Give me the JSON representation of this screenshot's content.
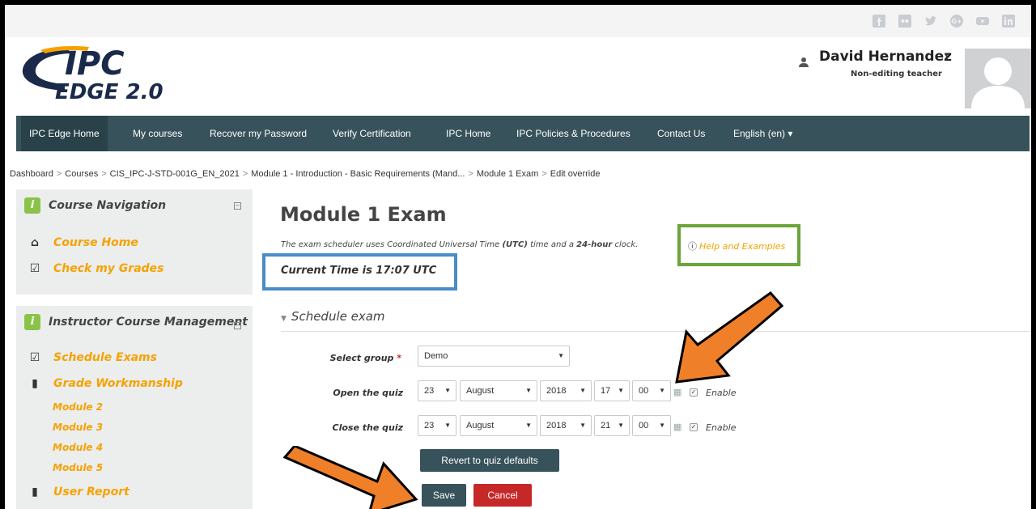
{
  "social": [
    {
      "name": "facebook-icon"
    },
    {
      "name": "flickr-icon"
    },
    {
      "name": "twitter-icon"
    },
    {
      "name": "google-plus-icon"
    },
    {
      "name": "youtube-icon"
    },
    {
      "name": "linkedin-icon"
    }
  ],
  "logo": {
    "line1": "IPC",
    "line2": "EDGE 2.0"
  },
  "user": {
    "name": "David Hernandez",
    "role": "Non-editing teacher"
  },
  "nav": {
    "items": [
      "IPC Edge Home",
      "My courses",
      "Recover my Password",
      "Verify Certification",
      "IPC Home",
      "IPC Policies & Procedures",
      "Contact Us",
      "English (en) ▾"
    ]
  },
  "breadcrumb": [
    "Dashboard",
    "Courses",
    "CIS_IPC-J-STD-001G_EN_2021",
    "Module 1 - Introduction - Basic Requirements (Mand...",
    "Module 1 Exam",
    "Edit override"
  ],
  "sidebar": {
    "course_nav_title": "Course Navigation",
    "course_home": "Course Home",
    "check_grades": "Check my Grades",
    "mgmt_title": "Instructor Course Management",
    "schedule_exams": "Schedule Exams",
    "grade_workmanship": "Grade Workmanship",
    "modules": [
      "Module 2",
      "Module 3",
      "Module 4",
      "Module 5"
    ],
    "user_report": "User Report"
  },
  "main": {
    "title": "Module 1 Exam",
    "intro_prefix": "The exam scheduler uses Coordinated Universal Time ",
    "intro_utc": "(UTC)",
    "intro_mid": " time and a ",
    "intro_24": "24-hour",
    "intro_suffix": " clock.",
    "help": "Help and Examples",
    "current_time": "Current Time is 17:07 UTC",
    "section": "Schedule exam"
  },
  "form": {
    "group_label": "Select group",
    "group_value": "Demo",
    "open_label": "Open the quiz",
    "open": {
      "day": "23",
      "month": "August",
      "year": "2018",
      "hour": "17",
      "minute": "00"
    },
    "close_label": "Close the quiz",
    "close": {
      "day": "23",
      "month": "August",
      "year": "2018",
      "hour": "21",
      "minute": "00"
    },
    "enable": "Enable",
    "revert": "Revert to quiz defaults",
    "save": "Save",
    "cancel": "Cancel"
  },
  "colors": {
    "nav": "#37525a",
    "accent": "#f5a200",
    "cancel": "#c62828",
    "arrow": "#ef7f29",
    "green_box": "#6aa53a",
    "blue_box": "#4a8bc8"
  }
}
